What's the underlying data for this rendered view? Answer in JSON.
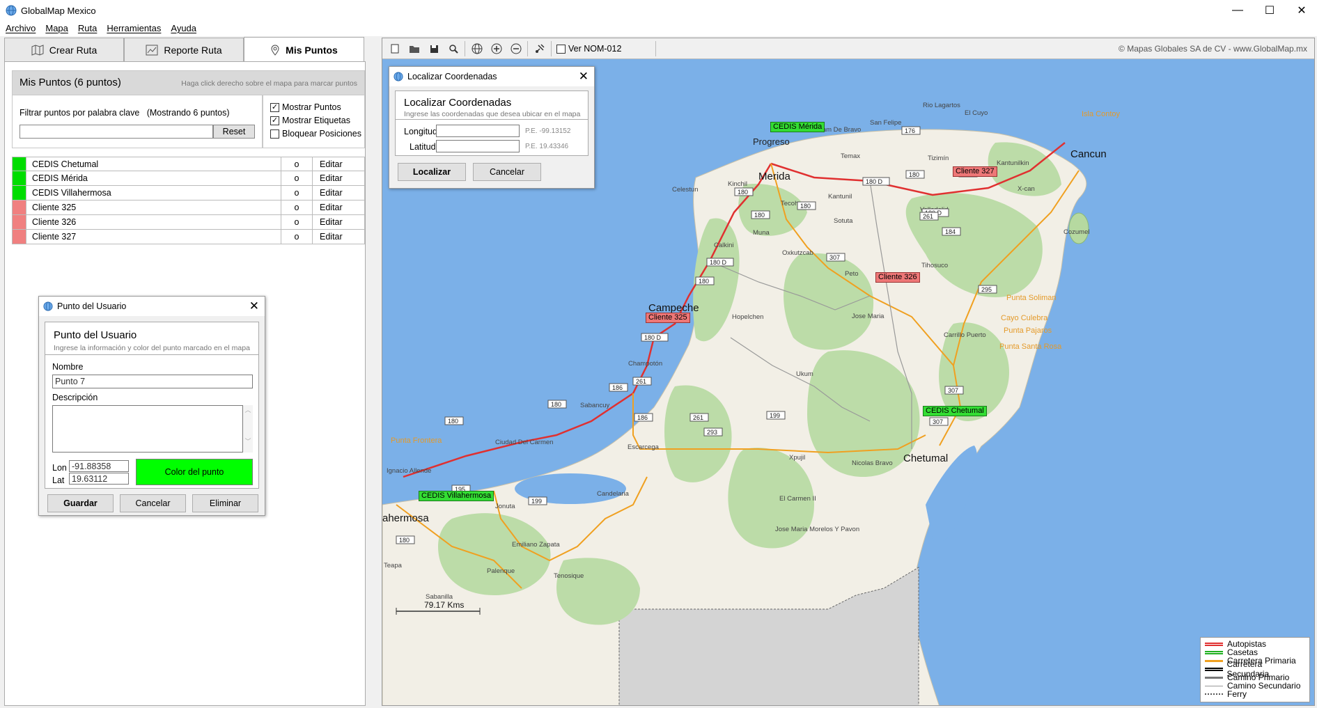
{
  "window": {
    "title": "GlobalMap Mexico",
    "minimize": "—",
    "maximize": "☐",
    "close": "✕"
  },
  "menu": [
    "Archivo",
    "Mapa",
    "Ruta",
    "Herramientas",
    "Ayuda"
  ],
  "tabs": [
    {
      "label": "Crear Ruta",
      "icon": "map-route-icon"
    },
    {
      "label": "Reporte Ruta",
      "icon": "chart-report-icon"
    },
    {
      "label": "Mis Puntos",
      "icon": "location-pin-icon",
      "active": true
    }
  ],
  "mis_puntos": {
    "header": "Mis Puntos (6 puntos)",
    "hint": "Haga click derecho sobre el mapa para marcar puntos",
    "filter_label": "Filtrar puntos por palabra clave   (Mostrando 6 puntos)",
    "filter_value": "",
    "reset_label": "Reset",
    "checkboxes": [
      {
        "label": "Mostrar Puntos",
        "checked": true
      },
      {
        "label": "Mostrar Etiquetas",
        "checked": true
      },
      {
        "label": "Bloquear Posiciones",
        "checked": false
      }
    ],
    "points": [
      {
        "name": "CEDIS Chetumal",
        "color": "#00dd00",
        "o": "o",
        "edit": "Editar"
      },
      {
        "name": "CEDIS Mérida",
        "color": "#00dd00",
        "o": "o",
        "edit": "Editar"
      },
      {
        "name": "CEDIS Villahermosa",
        "color": "#00dd00",
        "o": "o",
        "edit": "Editar"
      },
      {
        "name": "Cliente 325",
        "color": "#f08080",
        "o": "o",
        "edit": "Editar"
      },
      {
        "name": "Cliente 326",
        "color": "#f08080",
        "o": "o",
        "edit": "Editar"
      },
      {
        "name": "Cliente 327",
        "color": "#f08080",
        "o": "o",
        "edit": "Editar"
      }
    ]
  },
  "punto_dialog": {
    "title": "Punto del Usuario",
    "heading": "Punto del Usuario",
    "subheading": "Ingrese la información y color del punto marcado en el mapa",
    "nombre_label": "Nombre",
    "nombre_value": "Punto 7",
    "descripcion_label": "Descripción",
    "lon_label": "Lon",
    "lon_value": "-91.88358",
    "lat_label": "Lat",
    "lat_value": "19.63112",
    "color_button": "Color del punto",
    "color": "#00ff00",
    "guardar": "Guardar",
    "cancelar": "Cancelar",
    "eliminar": "Eliminar"
  },
  "coord_dialog": {
    "title": "Localizar Coordenadas",
    "heading": "Localizar Coordenadas",
    "subheading": "Ingrese las coordenadas que desea ubicar en el mapa",
    "longitud_label": "Longitud",
    "longitud_value": "",
    "longitud_example": "P.E. -99.13152",
    "latitud_label": "Latitud",
    "latitud_value": "",
    "latitud_example": "P.E. 19.43346",
    "localizar": "Localizar",
    "cancelar": "Cancelar"
  },
  "toolbar": {
    "nom_label": "Ver NOM-012",
    "nom_checked": false,
    "copyright": "© Mapas Globales SA de CV - www.GlobalMap.mx"
  },
  "map": {
    "markers": [
      {
        "label": "CEDIS Mérida",
        "type": "green"
      },
      {
        "label": "Cliente 327",
        "type": "red"
      },
      {
        "label": "Cliente 326",
        "type": "red"
      },
      {
        "label": "Cliente 325",
        "type": "red"
      },
      {
        "label": "CEDIS Chetumal",
        "type": "green"
      },
      {
        "label": "CEDIS Villahermosa",
        "type": "green"
      }
    ],
    "big_cities": [
      "Merida",
      "Cancun",
      "Campeche",
      "Chetumal",
      "ahermosa"
    ],
    "cities": [
      "Progreso",
      "Valladolid",
      "Champotón",
      "Ciudad Del Carmen",
      "Escarcega",
      "Palenque",
      "Tizimín",
      "Cozumel"
    ],
    "towns": [
      "Rio Lagartos",
      "El Cuyo",
      "San Felipe",
      "Dzilam De Bravo",
      "Temax",
      "Kantunilkin",
      "Celestun",
      "Kinchil",
      "Tecoh",
      "Kantunil",
      "Sotuta",
      "X-can",
      "Muna",
      "Calkini",
      "Oxkutzcab",
      "Peto",
      "Tihosuco",
      "Hopelchen",
      "Jose Maria",
      "Carrillo Puerto",
      "Ukum",
      "Sabancuy",
      "Xpujil",
      "Nicolas Bravo",
      "Candelaria",
      "El Carmen II",
      "Jose Maria Morelos Y Pavon",
      "Ignacio Allende",
      "Jonuta",
      "Emiliano Zapata",
      "Tenosique",
      "Teapa",
      "Sabanilla"
    ],
    "islands": [
      "Isla Contoy",
      "Punta Soliman",
      "Cayo Culebra",
      "Punta Pajaros",
      "Punta Santa Rosa",
      "Punta Frontera"
    ],
    "highways": [
      "176",
      "180",
      "180 D",
      "184",
      "295",
      "307",
      "261",
      "186",
      "199",
      "293",
      "195"
    ],
    "scale": "79.17 Kms"
  },
  "legend": [
    {
      "label": "Autopistas",
      "color": "#e03030",
      "style": "double"
    },
    {
      "label": "Casetas",
      "color": "#20b020",
      "style": "double"
    },
    {
      "label": "Carretera Primaria",
      "color": "#f0a020",
      "style": "single"
    },
    {
      "label": "Carretera Secundaria",
      "color": "#000000",
      "style": "double"
    },
    {
      "label": "Camino Primario",
      "color": "#777777",
      "style": "single"
    },
    {
      "label": "Camino Secundario",
      "color": "#999999",
      "style": "thin"
    },
    {
      "label": "Ferry",
      "color": "#555555",
      "style": "dotted"
    }
  ]
}
